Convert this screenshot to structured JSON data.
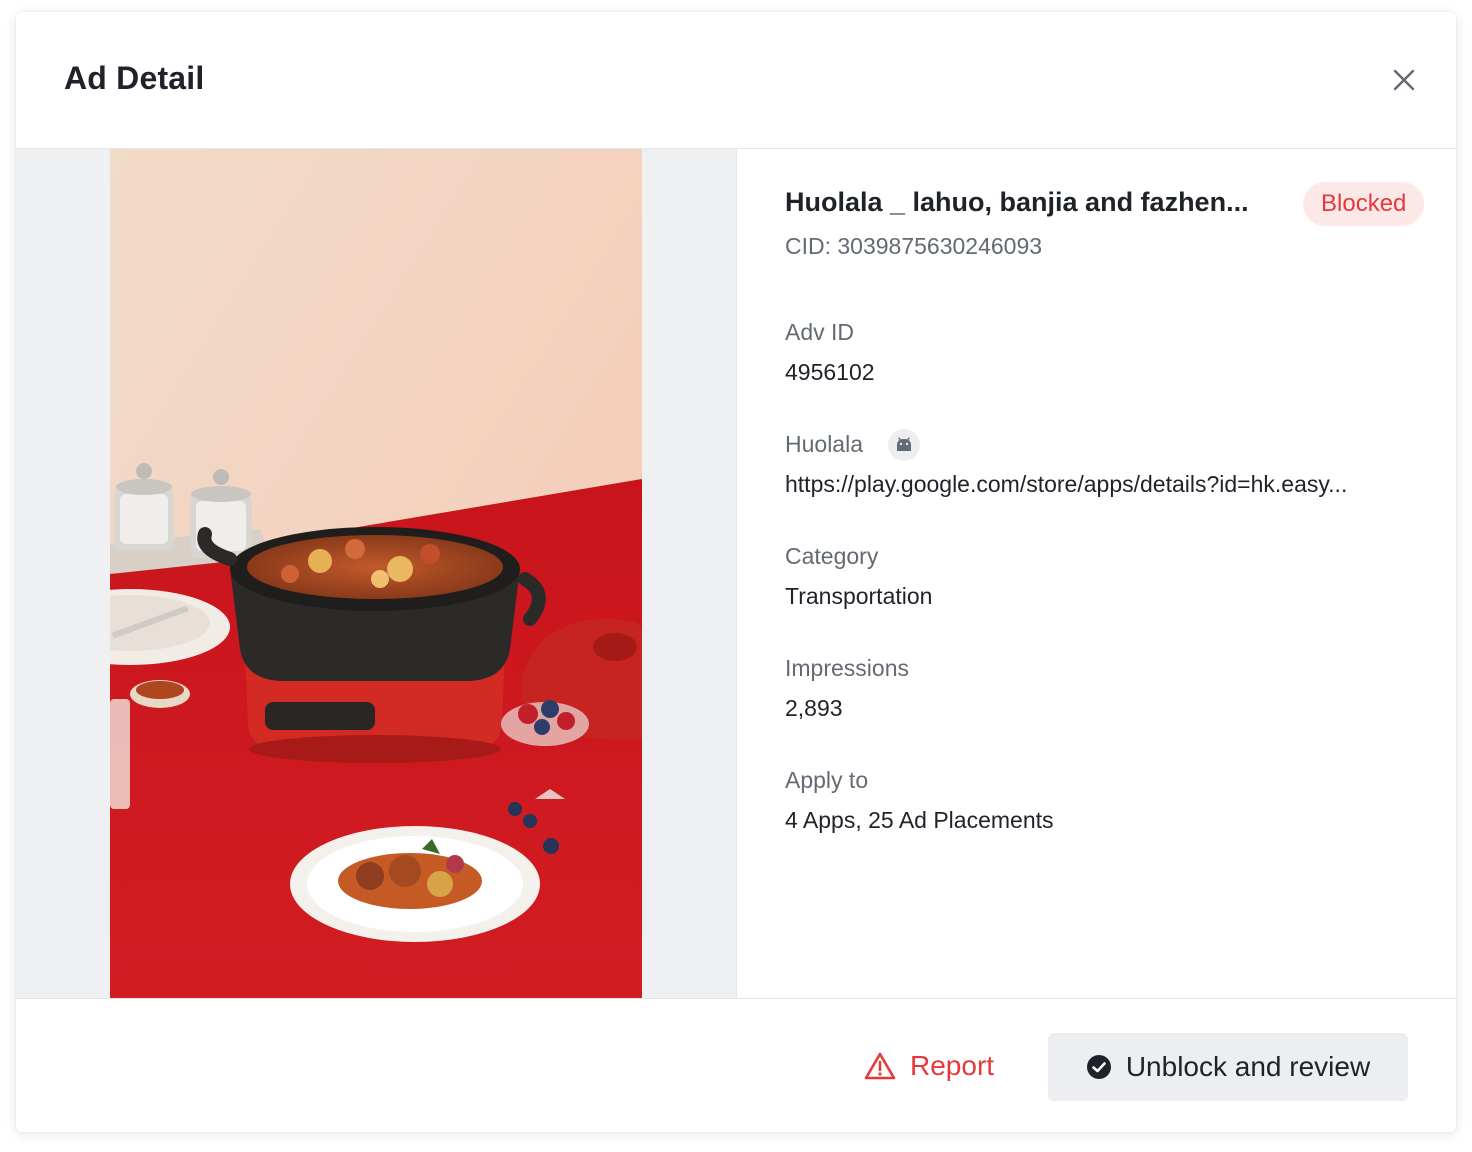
{
  "modal": {
    "title": "Ad Detail",
    "close_icon": "close-icon"
  },
  "ad": {
    "name": "Huolala _ lahuo, banjia and fazhen...",
    "status": "Blocked",
    "status_color": "#e5393a",
    "cid": "CID: 3039875630246093"
  },
  "fields": {
    "adv_id_label": "Adv ID",
    "adv_id_value": "4956102",
    "app_label": "Huolala",
    "app_platform_icon": "android-icon",
    "app_url": "https://play.google.com/store/apps/details?id=hk.easy...",
    "category_label": "Category",
    "category_value": "Transportation",
    "impressions_label": "Impressions",
    "impressions_value": "2,893",
    "apply_to_label": "Apply to",
    "apply_to_value": "4 Apps, 25 Ad Placements"
  },
  "footer": {
    "report_label": "Report",
    "report_icon": "warning-triangle-icon",
    "unblock_label": "Unblock and review",
    "unblock_icon": "check-circle-icon"
  },
  "colors": {
    "danger": "#e5393a",
    "danger_bg": "#fde8e8",
    "muted_text": "#646a73",
    "preview_bg": "#eff0f2"
  }
}
